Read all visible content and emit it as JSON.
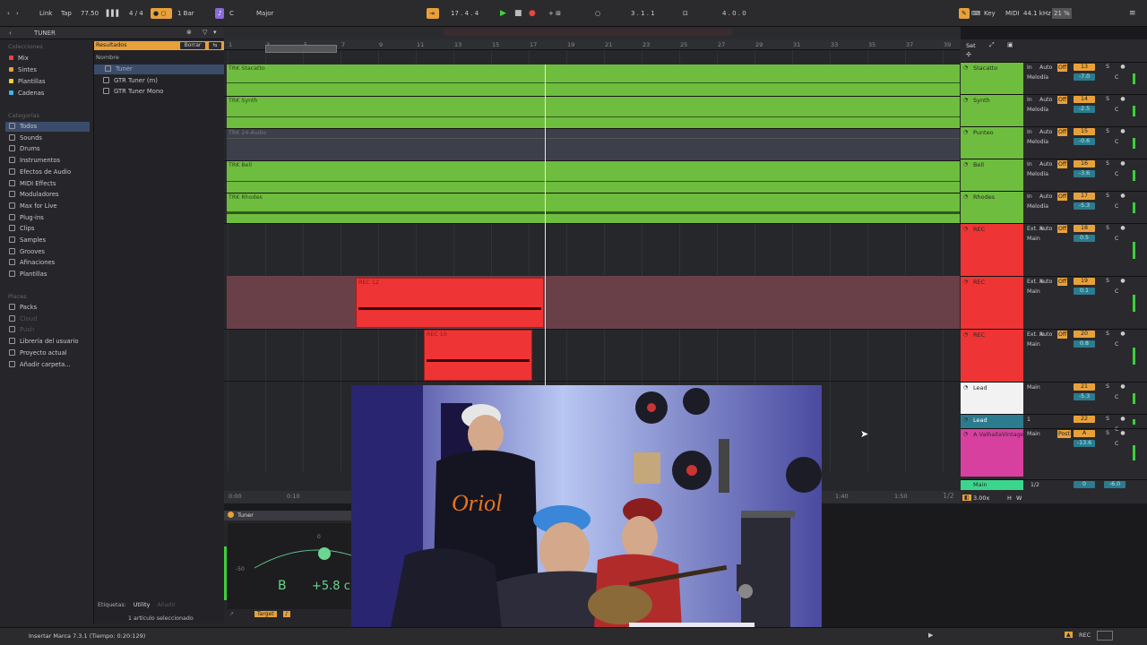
{
  "topbar": {
    "link": "Link",
    "tap": "Tap",
    "tempo": "77.50",
    "time_sig": "4 / 4",
    "bars": "1 Bar",
    "key_note": "C",
    "scale": "Major",
    "position": "17 . 4 . 4",
    "loop_start": "3 . 1 . 1",
    "loop_len": "4 . 0 . 0",
    "key_label": "Key",
    "midi_label": "MIDI",
    "sample_rate": "44.1 kHz",
    "cpu": "21 %"
  },
  "browser": {
    "search_title": "TUNER",
    "collections_heading": "Colecciones",
    "collections": [
      {
        "label": "Mix",
        "color": "#e84545"
      },
      {
        "label": "Sintes",
        "color": "#e8a13a"
      },
      {
        "label": "Plantillas",
        "color": "#e8d23a"
      },
      {
        "label": "Cadenas",
        "color": "#3ab9e8"
      }
    ],
    "categories_heading": "Categorías",
    "categories": [
      "Todos",
      "Sounds",
      "Drums",
      "Instrumentos",
      "Efectos de Audio",
      "MIDI Effects",
      "Moduladores",
      "Max for Live",
      "Plug-ins",
      "Clips",
      "Samples",
      "Grooves",
      "Afinaciones",
      "Plantillas"
    ],
    "places_heading": "Places",
    "places": [
      "Packs",
      "Cloud",
      "Push",
      "Librería del usuario",
      "Proyecto actual",
      "Añadir carpeta..."
    ],
    "results_label": "Resultados",
    "clear_label": "Borrar",
    "name_column": "Nombre",
    "results": [
      "Tuner",
      "GTR Tuner (m)",
      "GTR Tuner Mono"
    ],
    "tags_label": "Etiquetas:",
    "tag_utility": "Utility",
    "tag_add": "Añadir",
    "selected_info": "1 artículo seleccionado"
  },
  "ruler": [
    "1",
    "3",
    "5",
    "7",
    "9",
    "11",
    "13",
    "15",
    "17",
    "19",
    "21",
    "23",
    "25",
    "27",
    "29",
    "31",
    "33",
    "35",
    "37",
    "39"
  ],
  "time_ruler": [
    "0:00",
    "0:10",
    "1:40",
    "1:50"
  ],
  "clips": {
    "stacatto": "TRK Stacatto",
    "synth": "TRK Synth",
    "audio": "TRK 24-Audio",
    "bell": "TRK Bell",
    "rhodes": "TRK Rhodes",
    "rec1": "REC 12",
    "rec2": "REC 10"
  },
  "page_indicator": "1/2",
  "zoom": "3.00x",
  "mixer": {
    "set_label": "Set",
    "tracks": [
      {
        "name": "Stacatto",
        "num": "13",
        "vol": "-7.0",
        "in": "In",
        "auto": "Auto",
        "off": "Off",
        "src": "Melodía"
      },
      {
        "name": "Synth",
        "num": "14",
        "vol": "-2.5",
        "in": "In",
        "auto": "Auto",
        "off": "Off",
        "src": "Melodía"
      },
      {
        "name": "Punteo",
        "num": "15",
        "vol": "-0.6",
        "in": "In",
        "auto": "Auto",
        "off": "Off",
        "src": "Melodía"
      },
      {
        "name": "Bell",
        "num": "16",
        "vol": "-3.6",
        "in": "In",
        "auto": "Auto",
        "off": "Off",
        "src": "Melodía"
      },
      {
        "name": "Rhodes",
        "num": "17",
        "vol": "-5.3",
        "in": "In",
        "auto": "Auto",
        "off": "Off",
        "src": "Melodía"
      },
      {
        "name": "REC",
        "num": "18",
        "vol": "0.5",
        "in": "Ext. In",
        "auto": "Auto",
        "off": "Off",
        "src": "Main"
      },
      {
        "name": "REC",
        "num": "19",
        "vol": "0.1",
        "in": "Ext. In",
        "auto": "Auto",
        "off": "Off",
        "src": "Main"
      },
      {
        "name": "REC",
        "num": "20",
        "vol": "0.8",
        "in": "Ext. In",
        "auto": "Auto",
        "off": "Off",
        "src": "Main"
      },
      {
        "name": "Lead",
        "num": "21",
        "vol": "-5.3",
        "in": "Main",
        "auto": "",
        "off": "",
        "src": ""
      },
      {
        "name": "Lead",
        "num": "22",
        "vol": "",
        "in": "1",
        "auto": "",
        "off": "",
        "src": ""
      },
      {
        "name": "A ValhallaVintage",
        "num": "A",
        "vol": "-13.6",
        "in": "Main",
        "auto": "",
        "off": "Post",
        "src": ""
      }
    ],
    "master_name": "Main",
    "master_out": "1/2",
    "master_vol": "0",
    "master_pan": "-6.0"
  },
  "device": {
    "title": "Tuner",
    "note": "B",
    "cents": "+5.8 c",
    "scale_top": "0",
    "scale_left": "-50",
    "target_label": "Target"
  },
  "status_text": "Insertar Marca 7.3.1 (Tiempo: 0:20:129)",
  "status_rec": "REC"
}
